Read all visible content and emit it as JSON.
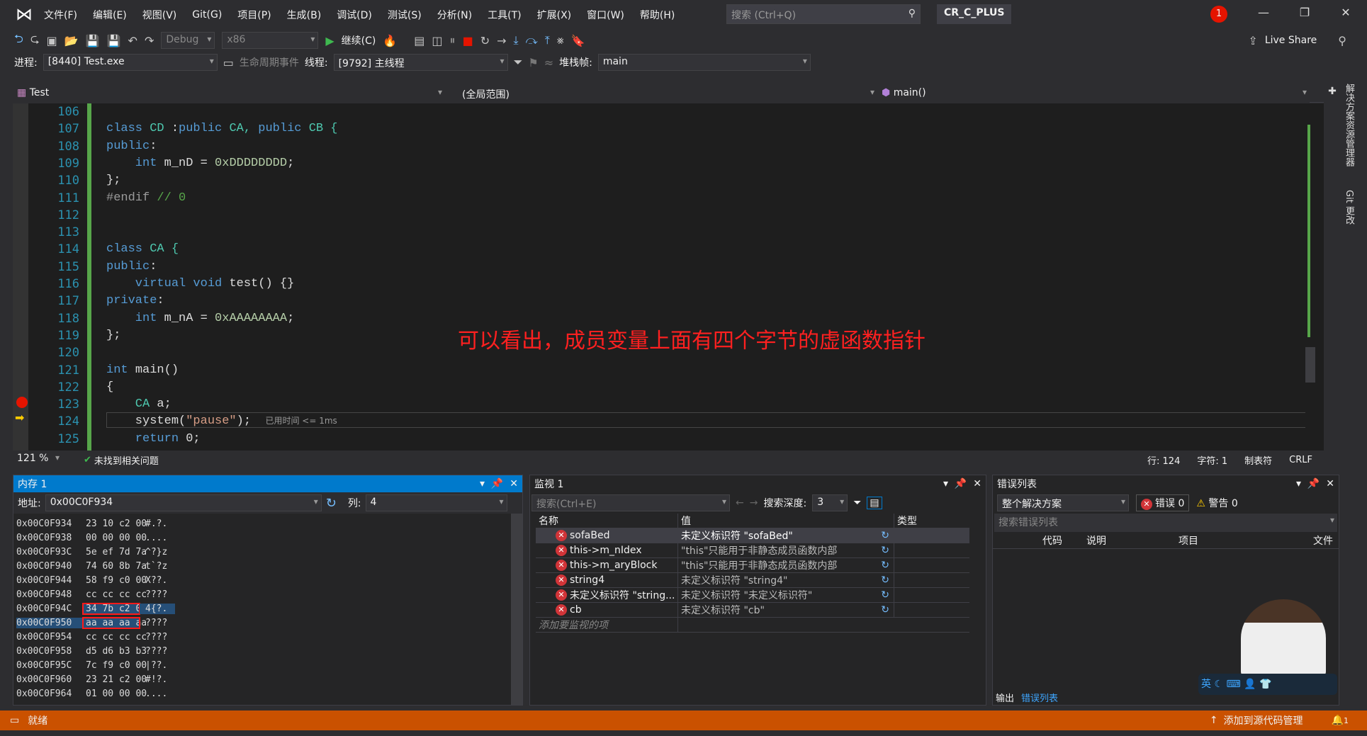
{
  "menu": {
    "items": [
      "文件(F)",
      "编辑(E)",
      "视图(V)",
      "Git(G)",
      "项目(P)",
      "生成(B)",
      "调试(D)",
      "测试(S)",
      "分析(N)",
      "工具(T)",
      "扩展(X)",
      "窗口(W)",
      "帮助(H)"
    ],
    "search_placeholder": "搜索 (Ctrl+Q)",
    "project": "CR_C_PLUS",
    "notification_count": "1"
  },
  "toolbar": {
    "config": "Debug",
    "platform": "x86",
    "continue": "继续(C)",
    "live_share": "Live Share"
  },
  "debugbar": {
    "process_label": "进程:",
    "process": "[8440] Test.exe",
    "lifecycle": "生命周期事件",
    "thread_label": "线程:",
    "thread": "[9792] 主线程",
    "stack_label": "堆栈帧:",
    "stack": "main"
  },
  "nav": {
    "project": "Test",
    "scope": "(全局范围)",
    "function": "main()"
  },
  "side_tabs": [
    "解决方案资源管理器",
    "Git 更改"
  ],
  "editor": {
    "lines": [
      {
        "n": "106",
        "tokens": []
      },
      {
        "n": "107",
        "tokens": [
          {
            "t": "class ",
            "k": "kw"
          },
          {
            "t": "CD ",
            "k": "ty"
          },
          {
            "t": ":",
            "k": ""
          },
          {
            "t": "public ",
            "k": "kw"
          },
          {
            "t": "CA, ",
            "k": "ty"
          },
          {
            "t": "public ",
            "k": "kw"
          },
          {
            "t": "CB {",
            "k": "ty"
          }
        ]
      },
      {
        "n": "108",
        "tokens": [
          {
            "t": "public",
            "k": "kw"
          },
          {
            "t": ":",
            "k": ""
          }
        ]
      },
      {
        "n": "109",
        "tokens": [
          {
            "t": "    int ",
            "k": "kw"
          },
          {
            "t": "m_nD = ",
            "k": ""
          },
          {
            "t": "0xDDDDDDDD",
            "k": "nm"
          },
          {
            "t": ";",
            "k": ""
          }
        ]
      },
      {
        "n": "110",
        "tokens": [
          {
            "t": "};",
            "k": ""
          }
        ]
      },
      {
        "n": "111",
        "tokens": [
          {
            "t": "#endif ",
            "k": "pp"
          },
          {
            "t": "// 0",
            "k": "cm"
          }
        ]
      },
      {
        "n": "112",
        "tokens": []
      },
      {
        "n": "113",
        "tokens": []
      },
      {
        "n": "114",
        "tokens": [
          {
            "t": "class ",
            "k": "kw"
          },
          {
            "t": "CA {",
            "k": "ty"
          }
        ]
      },
      {
        "n": "115",
        "tokens": [
          {
            "t": "public",
            "k": "kw"
          },
          {
            "t": ":",
            "k": ""
          }
        ]
      },
      {
        "n": "116",
        "tokens": [
          {
            "t": "    virtual void ",
            "k": "kw"
          },
          {
            "t": "test() {}",
            "k": ""
          }
        ]
      },
      {
        "n": "117",
        "tokens": [
          {
            "t": "private",
            "k": "kw"
          },
          {
            "t": ":",
            "k": ""
          }
        ]
      },
      {
        "n": "118",
        "tokens": [
          {
            "t": "    int ",
            "k": "kw"
          },
          {
            "t": "m_nA = ",
            "k": ""
          },
          {
            "t": "0xAAAAAAAA",
            "k": "nm"
          },
          {
            "t": ";",
            "k": ""
          }
        ]
      },
      {
        "n": "119",
        "tokens": [
          {
            "t": "};",
            "k": ""
          }
        ]
      },
      {
        "n": "120",
        "tokens": []
      },
      {
        "n": "121",
        "tokens": [
          {
            "t": "int ",
            "k": "kw"
          },
          {
            "t": "main()",
            "k": ""
          }
        ]
      },
      {
        "n": "122",
        "tokens": [
          {
            "t": "{",
            "k": ""
          }
        ]
      },
      {
        "n": "123",
        "tokens": [
          {
            "t": "    CA ",
            "k": "ty"
          },
          {
            "t": "a;",
            "k": ""
          }
        ]
      },
      {
        "n": "124",
        "tokens": [
          {
            "t": "    system(",
            "k": ""
          },
          {
            "t": "\"pause\"",
            "k": "st"
          },
          {
            "t": ");  ",
            "k": ""
          },
          {
            "t": "已用时间 <= 1ms",
            "k": "tm"
          }
        ]
      },
      {
        "n": "125",
        "tokens": [
          {
            "t": "    return ",
            "k": "kw"
          },
          {
            "t": "0;",
            "k": ""
          }
        ]
      }
    ],
    "annotation": "可以看出，成员变量上面有四个字节的虚函数指针",
    "breakpoint_line": "123",
    "current_line": "124"
  },
  "editor_status": {
    "zoom": "121 %",
    "issues": "未找到相关问题",
    "line": "行: 124",
    "char": "字符: 1",
    "tabs": "制表符",
    "eol": "CRLF"
  },
  "memory": {
    "title": "内存 1",
    "addr_label": "地址:",
    "address": "0x00C0F934",
    "col_label": "列:",
    "columns": "4",
    "rows": [
      {
        "addr": "0x00C0F934",
        "bytes": "23 10 c2 00",
        "ascii": "#.?."
      },
      {
        "addr": "0x00C0F938",
        "bytes": "00 00 00 00",
        "ascii": "...."
      },
      {
        "addr": "0x00C0F93C",
        "bytes": "5e ef 7d 7a",
        "ascii": "^?}z"
      },
      {
        "addr": "0x00C0F940",
        "bytes": "74 60 8b 7a",
        "ascii": "t`?z"
      },
      {
        "addr": "0x00C0F944",
        "bytes": "58 f9 c0 00",
        "ascii": "X??."
      },
      {
        "addr": "0x00C0F948",
        "bytes": "cc cc cc cc",
        "ascii": "????"
      },
      {
        "addr": "0x00C0F94C",
        "bytes": "34 7b c2 00",
        "ascii": "4{?.",
        "hl": true
      },
      {
        "addr": "0x00C0F950",
        "bytes": "aa aa aa aa",
        "ascii": "????",
        "hl": true
      },
      {
        "addr": "0x00C0F954",
        "bytes": "cc cc cc cc",
        "ascii": "????"
      },
      {
        "addr": "0x00C0F958",
        "bytes": "d5 d6 b3 b3",
        "ascii": "????"
      },
      {
        "addr": "0x00C0F95C",
        "bytes": "7c f9 c0 00",
        "ascii": "|??."
      },
      {
        "addr": "0x00C0F960",
        "bytes": "23 21 c2 00",
        "ascii": "#!?."
      },
      {
        "addr": "0x00C0F964",
        "bytes": "01 00 00 00",
        "ascii": "...."
      }
    ]
  },
  "watch": {
    "title": "监视 1",
    "search_placeholder": "搜索(Ctrl+E)",
    "depth_label": "搜索深度:",
    "depth": "3",
    "headers": [
      "名称",
      "值",
      "类型"
    ],
    "rows": [
      {
        "name": "sofaBed",
        "value": "未定义标识符 \"sofaBed\""
      },
      {
        "name": "this->m_nIdex",
        "value": "\"this\"只能用于非静态成员函数内部"
      },
      {
        "name": "this->m_aryBlock",
        "value": "\"this\"只能用于非静态成员函数内部"
      },
      {
        "name": "string4",
        "value": "未定义标识符 \"string4\""
      },
      {
        "name": "未定义标识符 \"string...",
        "value": "未定义标识符 \"未定义标识符\""
      },
      {
        "name": "cb",
        "value": "未定义标识符 \"cb\""
      }
    ],
    "add_placeholder": "添加要监视的项"
  },
  "errors": {
    "title": "错误列表",
    "scope": "整个解决方案",
    "errors": "错误 0",
    "warnings": "警告 0",
    "search_placeholder": "搜索错误列表",
    "headers": [
      "代码",
      "说明",
      "项目",
      "文件"
    ],
    "tabs": [
      "输出",
      "错误列表"
    ]
  },
  "statusbar": {
    "status": "就绪",
    "source_control": "添加到源代码管理",
    "notif": "1"
  },
  "colors": {
    "accent": "#007acc",
    "statusbar": "#ca5100",
    "annotation": "#ff2020"
  }
}
